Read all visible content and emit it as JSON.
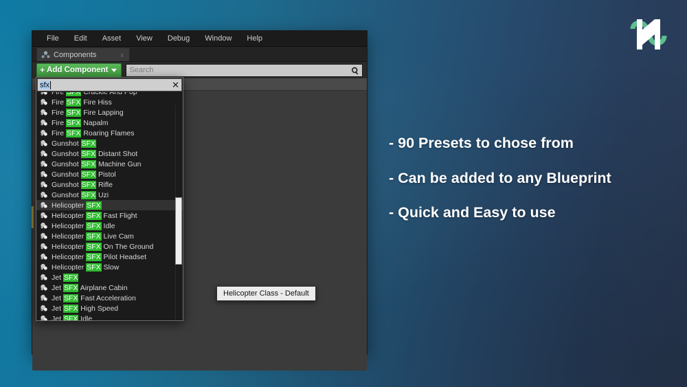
{
  "window": {
    "menu_items": [
      "File",
      "Edit",
      "Asset",
      "View",
      "Debug",
      "Window",
      "Help"
    ],
    "tab": {
      "label": "Components",
      "icon": "components-icon",
      "close": "x"
    },
    "toolbar": {
      "add_component_label": "Add Component",
      "add_component_plus": "+",
      "search_placeholder": "Search",
      "search_value": ""
    }
  },
  "dropdown": {
    "search_value": "sfx",
    "clear_label": "✕",
    "items": [
      {
        "prefix": "Fire ",
        "highlight": "SFX",
        "suffix": " Crackle And Pop",
        "selected": false
      },
      {
        "prefix": "Fire ",
        "highlight": "SFX",
        "suffix": " Fire Hiss",
        "selected": false
      },
      {
        "prefix": "Fire ",
        "highlight": "SFX",
        "suffix": " Fire Lapping",
        "selected": false
      },
      {
        "prefix": "Fire ",
        "highlight": "SFX",
        "suffix": " Napalm",
        "selected": false
      },
      {
        "prefix": "Fire ",
        "highlight": "SFX",
        "suffix": " Roaring Flames",
        "selected": false
      },
      {
        "prefix": "Gunshot ",
        "highlight": "SFX",
        "suffix": "",
        "selected": false
      },
      {
        "prefix": "Gunshot ",
        "highlight": "SFX",
        "suffix": " Distant Shot",
        "selected": false
      },
      {
        "prefix": "Gunshot ",
        "highlight": "SFX",
        "suffix": " Machine Gun",
        "selected": false
      },
      {
        "prefix": "Gunshot ",
        "highlight": "SFX",
        "suffix": " Pistol",
        "selected": false
      },
      {
        "prefix": "Gunshot ",
        "highlight": "SFX",
        "suffix": " Rifle",
        "selected": false
      },
      {
        "prefix": "Gunshot ",
        "highlight": "SFX",
        "suffix": " Uzi",
        "selected": false
      },
      {
        "prefix": "Helicopter ",
        "highlight": "SFX",
        "suffix": "",
        "selected": true
      },
      {
        "prefix": "Helicopter ",
        "highlight": "SFX",
        "suffix": " Fast Flight",
        "selected": false
      },
      {
        "prefix": "Helicopter ",
        "highlight": "SFX",
        "suffix": " Idle",
        "selected": false
      },
      {
        "prefix": "Helicopter ",
        "highlight": "SFX",
        "suffix": " Live Cam",
        "selected": false
      },
      {
        "prefix": "Helicopter ",
        "highlight": "SFX",
        "suffix": " On The Ground",
        "selected": false
      },
      {
        "prefix": "Helicopter ",
        "highlight": "SFX",
        "suffix": " Pilot Headset",
        "selected": false
      },
      {
        "prefix": "Helicopter ",
        "highlight": "SFX",
        "suffix": " Slow",
        "selected": false
      },
      {
        "prefix": "Jet ",
        "highlight": "SFX",
        "suffix": "",
        "selected": false
      },
      {
        "prefix": "Jet ",
        "highlight": "SFX",
        "suffix": " Airplane Cabin",
        "selected": false
      },
      {
        "prefix": "Jet ",
        "highlight": "SFX",
        "suffix": " Fast Acceleration",
        "selected": false
      },
      {
        "prefix": "Jet ",
        "highlight": "SFX",
        "suffix": " High Speed",
        "selected": false
      },
      {
        "prefix": "Jet ",
        "highlight": "SFX",
        "suffix": " Idle",
        "selected": false
      }
    ]
  },
  "tooltip": {
    "text": "Helicopter Class - Default"
  },
  "bullets": [
    "- 90 Presets to chose from",
    "- Can be added to any Blueprint",
    "- Quick and Easy to use"
  ],
  "colors": {
    "accent_green": "#2fbb2f",
    "button_green": "#4aa94a",
    "bg_left": "#0f7ba5",
    "bg_right": "#2a3a55",
    "logo_green": "#5bbf8e"
  }
}
